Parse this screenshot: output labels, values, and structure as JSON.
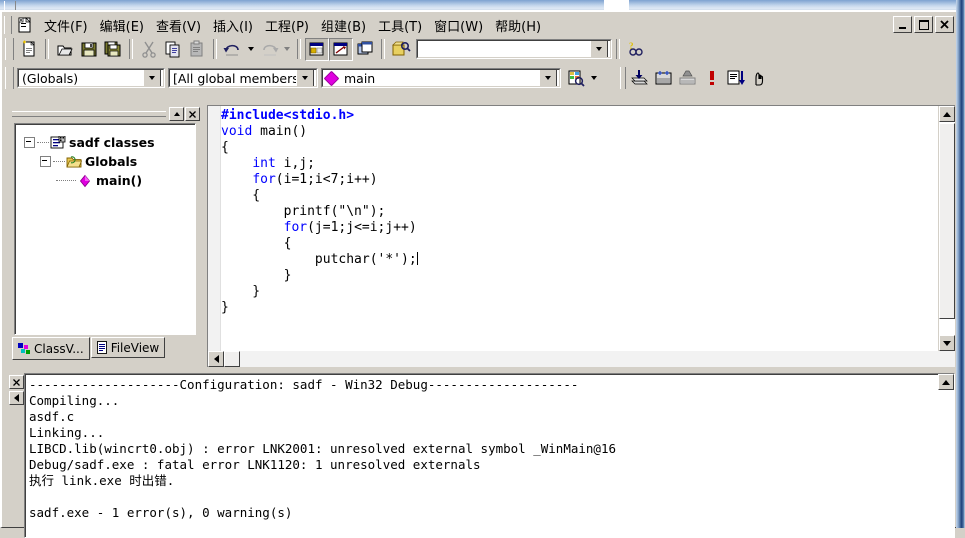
{
  "window": {
    "controls": {
      "minimize": "_",
      "restore": "❐",
      "close": "✕"
    }
  },
  "menubar": {
    "items": [
      {
        "label": "文件(F)",
        "name": "menu-file"
      },
      {
        "label": "编辑(E)",
        "name": "menu-edit"
      },
      {
        "label": "查看(V)",
        "name": "menu-view"
      },
      {
        "label": "插入(I)",
        "name": "menu-insert"
      },
      {
        "label": "工程(P)",
        "name": "menu-project"
      },
      {
        "label": "组建(B)",
        "name": "menu-build"
      },
      {
        "label": "工具(T)",
        "name": "menu-tools"
      },
      {
        "label": "窗口(W)",
        "name": "menu-window"
      },
      {
        "label": "帮助(H)",
        "name": "menu-help"
      }
    ]
  },
  "toolbar_standard": {
    "buttons": [
      "new-text-file-icon",
      "open-icon",
      "save-icon",
      "save-all-icon",
      "cut-icon",
      "copy-icon",
      "paste-icon",
      "undo-icon",
      "redo-icon",
      "workspace-icon",
      "output-window-icon",
      "window-list-icon",
      "find-in-files-icon"
    ],
    "find_box": {
      "value": "",
      "placeholder": ""
    },
    "help_button": "search-help-icon"
  },
  "toolbar_wizardbar": {
    "class_combo": {
      "value": "(Globals)"
    },
    "members_combo": {
      "value": "[All global members"
    },
    "function_combo": {
      "value": "main",
      "icon": "member-diamond-icon"
    },
    "action_button": "wizardbar-action-icon"
  },
  "toolbar_build": {
    "buttons": [
      "compile-icon",
      "build-icon",
      "build-execute-icon",
      "stop-build-icon",
      "go-icon",
      "insert-remove-breakpoint-icon"
    ]
  },
  "workspace": {
    "tree": {
      "root": {
        "label": "sadf classes",
        "icon": "class-folder-icon",
        "expanded": true
      },
      "globals": {
        "label": "Globals",
        "icon": "globals-folder-icon",
        "expanded": true
      },
      "main": {
        "label": "main()",
        "icon": "member-diamond-icon"
      }
    },
    "tabs": [
      {
        "label": "ClassV...",
        "icon": "classview-icon",
        "active": true,
        "name": "tab-classview"
      },
      {
        "label": "FileView",
        "icon": "fileview-icon",
        "active": false,
        "name": "tab-fileview"
      }
    ]
  },
  "editor": {
    "lines": [
      [
        {
          "t": "#include<stdio.h>",
          "c": "pp"
        }
      ],
      [
        {
          "t": "void",
          "c": "kw"
        },
        {
          "t": " main()",
          "c": ""
        }
      ],
      [
        {
          "t": "{",
          "c": ""
        }
      ],
      [
        {
          "t": "    ",
          "c": ""
        },
        {
          "t": "int",
          "c": "kw"
        },
        {
          "t": " i,j;",
          "c": ""
        }
      ],
      [
        {
          "t": "    ",
          "c": ""
        },
        {
          "t": "for",
          "c": "kw"
        },
        {
          "t": "(i=1;i<7;i++)",
          "c": ""
        }
      ],
      [
        {
          "t": "    {",
          "c": ""
        }
      ],
      [
        {
          "t": "        printf(\"\\n\");",
          "c": ""
        }
      ],
      [
        {
          "t": "        ",
          "c": ""
        },
        {
          "t": "for",
          "c": "kw"
        },
        {
          "t": "(j=1;j<=i;j++)",
          "c": ""
        }
      ],
      [
        {
          "t": "        {",
          "c": ""
        }
      ],
      [
        {
          "t": "            putchar('*');",
          "c": ""
        }
      ],
      [
        {
          "t": "        }",
          "c": ""
        }
      ],
      [
        {
          "t": "    }",
          "c": ""
        }
      ],
      [
        {
          "t": "}",
          "c": ""
        }
      ]
    ]
  },
  "output": {
    "lines": [
      "--------------------Configuration: sadf - Win32 Debug--------------------",
      "Compiling...",
      "asdf.c",
      "Linking...",
      "LIBCD.lib(wincrt0.obj) : error LNK2001: unresolved external symbol _WinMain@16",
      "Debug/sadf.exe : fatal error LNK1120: 1 unresolved externals",
      "执行 link.exe 时出错.",
      "",
      "sadf.exe - 1 error(s), 0 warning(s)"
    ],
    "close_label": "✕"
  },
  "colors": {
    "face": "#d4d0c8",
    "keyword": "#0000ff",
    "preprocessor": "#0000ff",
    "diamond": "#e000e0",
    "titlebar_blue": "#1d3f7a"
  }
}
